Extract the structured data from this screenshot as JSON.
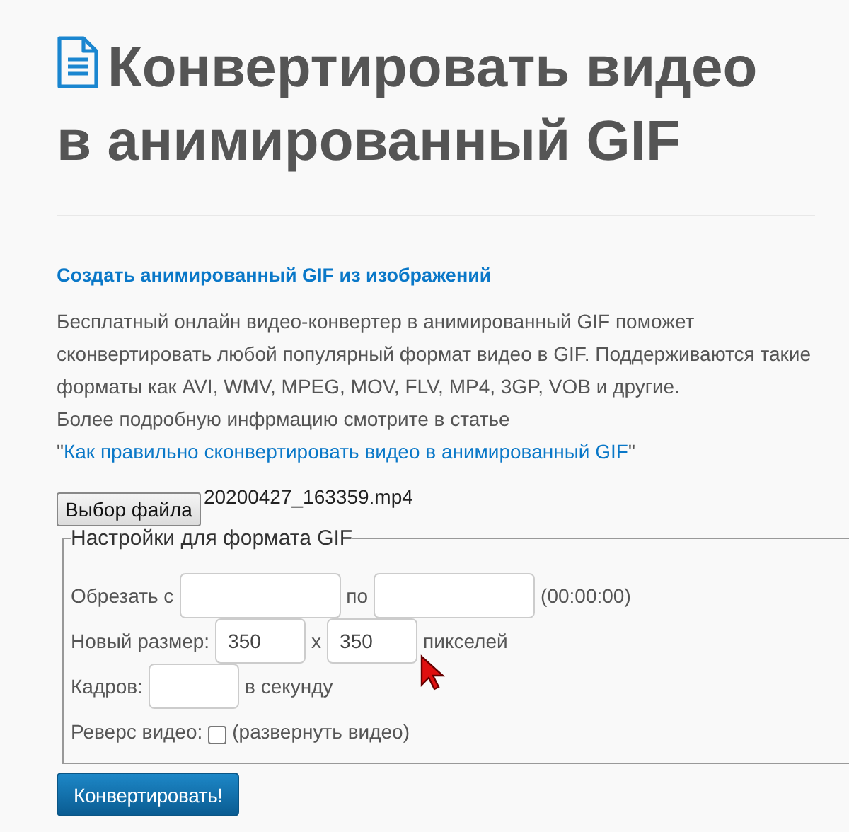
{
  "header": {
    "title": "Конвертировать видео в анимированный GIF"
  },
  "images_link": "Создать анимированный GIF из изображений",
  "description": "Бесплатный онлайн видео-конвертер в анимированный GIF поможет сконвертировать любой популярный формат видео в GIF. Поддерживаются такие форматы как AVI, WMV, MPEG, MOV, FLV, MP4, 3GP, VOB и другие.",
  "more_info": {
    "before": "Более подробную инфрмацию смотрите в статье",
    "open_quote": "\"",
    "link": "Как правильно сконвертировать видео в анимированный GIF",
    "close_quote": "\""
  },
  "file_picker": {
    "button": "Выбор файла",
    "file_name": "20200427_163359.mp4"
  },
  "settings": {
    "legend": "Настройки для формата GIF",
    "rows": [
      {
        "parts": [
          {
            "kind": "text",
            "text": "Обрезать с"
          },
          {
            "kind": "time-field"
          },
          {
            "kind": "text",
            "text": "по"
          },
          {
            "kind": "time-field"
          },
          {
            "kind": "text",
            "text": "(00:00:00)"
          }
        ]
      },
      {
        "parts": [
          {
            "kind": "text",
            "text": "Новый размер:"
          },
          {
            "kind": "field",
            "value": "350"
          },
          {
            "kind": "text",
            "text": "x"
          },
          {
            "kind": "field",
            "value": "350"
          },
          {
            "kind": "text",
            "text": "пикселей"
          }
        ]
      },
      {
        "parts": [
          {
            "kind": "text",
            "text": "Кадров:"
          },
          {
            "kind": "field"
          },
          {
            "kind": "text",
            "text": "в секунду"
          }
        ]
      },
      {
        "parts": [
          {
            "kind": "text",
            "text": "Реверс видео:"
          },
          {
            "kind": "checkbox",
            "checked": false
          },
          {
            "kind": "text",
            "text": "(развернуть видео)"
          }
        ]
      }
    ]
  },
  "convert_button": "Конвертировать!"
}
